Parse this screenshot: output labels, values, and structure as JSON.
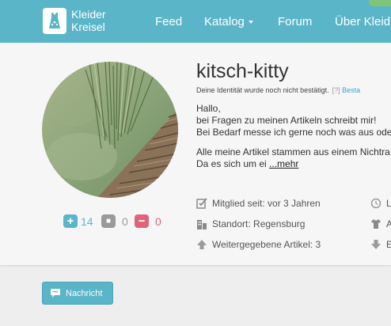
{
  "navbar": {
    "logo_line1": "Kleider",
    "logo_line2": "Kreisel",
    "items": [
      {
        "label": "Feed"
      },
      {
        "label": "Katalog"
      },
      {
        "label": "Forum"
      },
      {
        "label": "Über Kleid"
      }
    ]
  },
  "profile": {
    "username": "kitsch-kitty",
    "identity_notice": "Deine Identität wurde noch nicht bestätigt.",
    "identity_help": "[?]",
    "identity_link": "Besta",
    "bio": {
      "line1": "Hallo,",
      "line2": "bei Fragen zu meinen Artikeln schreibt mir!",
      "line3": "Bei Bedarf messe ich gerne noch was aus oder",
      "line4": "Alle meine Artikel stammen aus einem Nichtra",
      "line5": "Da es sich um ei ",
      "more_link": "...mehr"
    },
    "stats": {
      "positive": "14",
      "neutral": "0",
      "negative": "0"
    },
    "meta": {
      "member_since": "Mitglied seit: vor 3 Jahren",
      "location": "Standort: Regensburg",
      "items_passed": "Weitergegebene Artikel: 3",
      "right1": "L",
      "right2": "A",
      "right3": "E"
    }
  },
  "actions": {
    "message_button": "Nachricht"
  },
  "colors": {
    "brand": "#5ab5c8",
    "positive": "#5ab5c8",
    "neutral": "#9a9a9a",
    "negative": "#e0637c"
  },
  "icons": {
    "logo": "dress-icon",
    "positive": "plus-speech-icon",
    "neutral": "square-speech-icon",
    "negative": "minus-speech-icon",
    "member_since": "edit-check-icon",
    "location": "buildings-icon",
    "items_passed": "arrow-up-icon",
    "right1": "clock-icon",
    "right2": "shirt-icon",
    "right3": "arrow-down-icon",
    "message": "speech-bubble-icon"
  }
}
